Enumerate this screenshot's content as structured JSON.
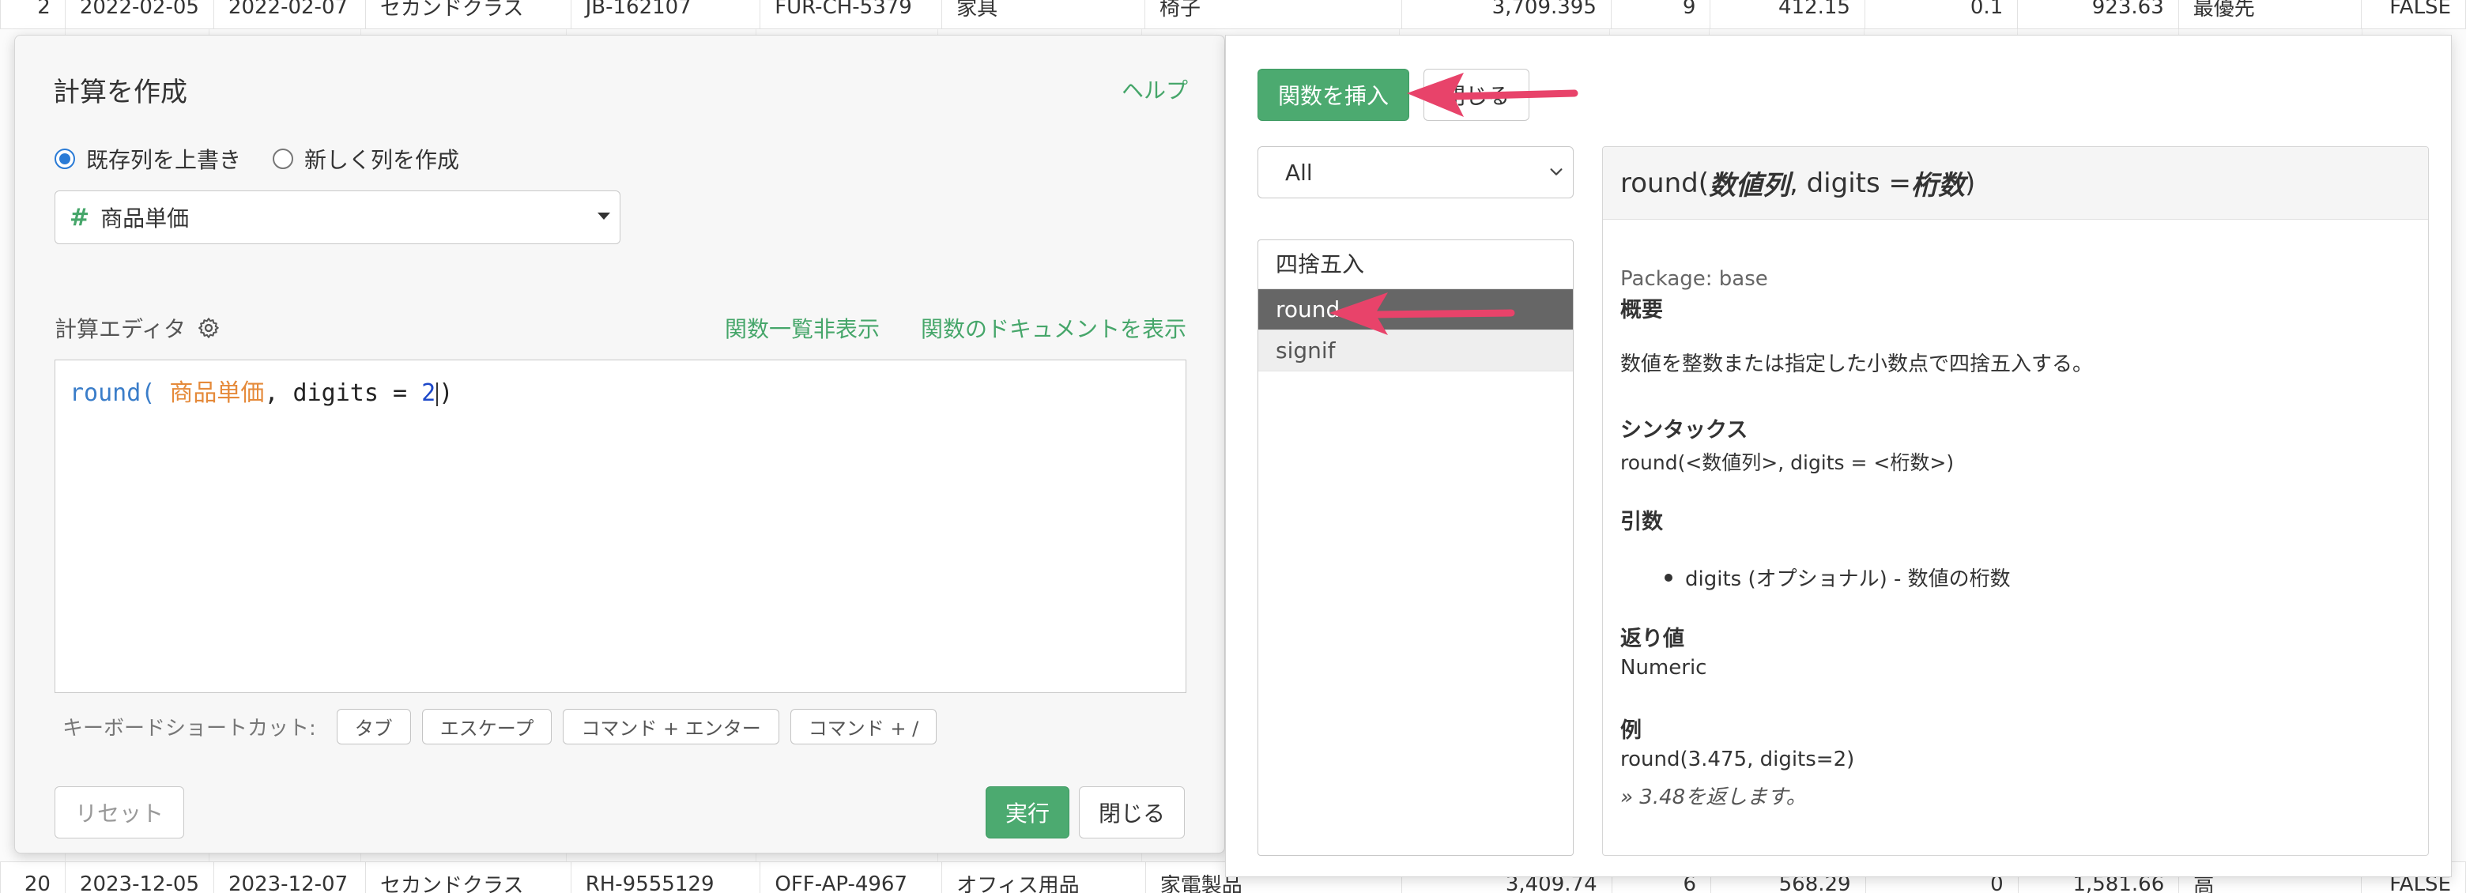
{
  "background_rows": {
    "top": [
      "2",
      "2022-02-05",
      "2022-02-07",
      "セカンドクラス",
      "JB-162107",
      "FUR-CH-5379",
      "家具",
      "椅子",
      "3,709.395",
      "9",
      "412.15",
      "0.1",
      "923.63",
      "最優先",
      "FALSE"
    ],
    "bottom": [
      "20",
      "2023-12-05",
      "2023-12-07",
      "セカンドクラス",
      "RH-9555129",
      "OFF-AP-4967",
      "オフィス用品",
      "家電製品",
      "3,409.74",
      "6",
      "568.29",
      "0",
      "1,581.66",
      "高",
      "FALSE"
    ]
  },
  "left_dialog": {
    "title": "計算を作成",
    "help": "ヘルプ",
    "radio_overwrite": "既存列を上書き",
    "radio_new": "新しく列を作成",
    "column_hash": "#",
    "column_selected": "商品単価",
    "editor_label": "計算エディタ",
    "hide_functions": "関数一覧非表示",
    "show_docs": "関数のドキュメントを表示",
    "code": {
      "fn": "round",
      "open": "(",
      "col": " 商品単価",
      "sep": ", digits = ",
      "num": "2",
      "close": ")"
    },
    "shortcuts_label": "キーボードショートカット:",
    "shortcuts": [
      "タブ",
      "エスケープ",
      "コマンド + エンター",
      "コマンド + /"
    ],
    "reset": "リセット",
    "run": "実行",
    "close": "閉じる"
  },
  "right_panel": {
    "insert_function": "関数を挿入",
    "close": "閉じる",
    "category": "All",
    "function_group": "四捨五入",
    "functions": [
      "round",
      "signif"
    ],
    "selected_function": "round",
    "doc": {
      "sig_fn": "round(",
      "sig_arg1": "数値列",
      "sig_mid": ", digits = ",
      "sig_arg2": "桁数",
      "sig_close": ")",
      "package": "Package: base",
      "overview_h": "概要",
      "overview": "数値を整数または指定した小数点で四捨五入する。",
      "syntax_h": "シンタックス",
      "syntax": "round(<数値列>, digits = <桁数>)",
      "args_h": "引数",
      "arg1": "digits (オプショナル) - 数値の桁数",
      "return_h": "返り値",
      "return": "Numeric",
      "example_h": "例",
      "example": "round(3.475, digits=2)",
      "example_result": "» 3.48を返します。"
    }
  },
  "colors": {
    "accent_green": "#4caa70",
    "link_green": "#46a66a",
    "annotation_arrow": "#e8436a",
    "selected_row": "#666666"
  }
}
